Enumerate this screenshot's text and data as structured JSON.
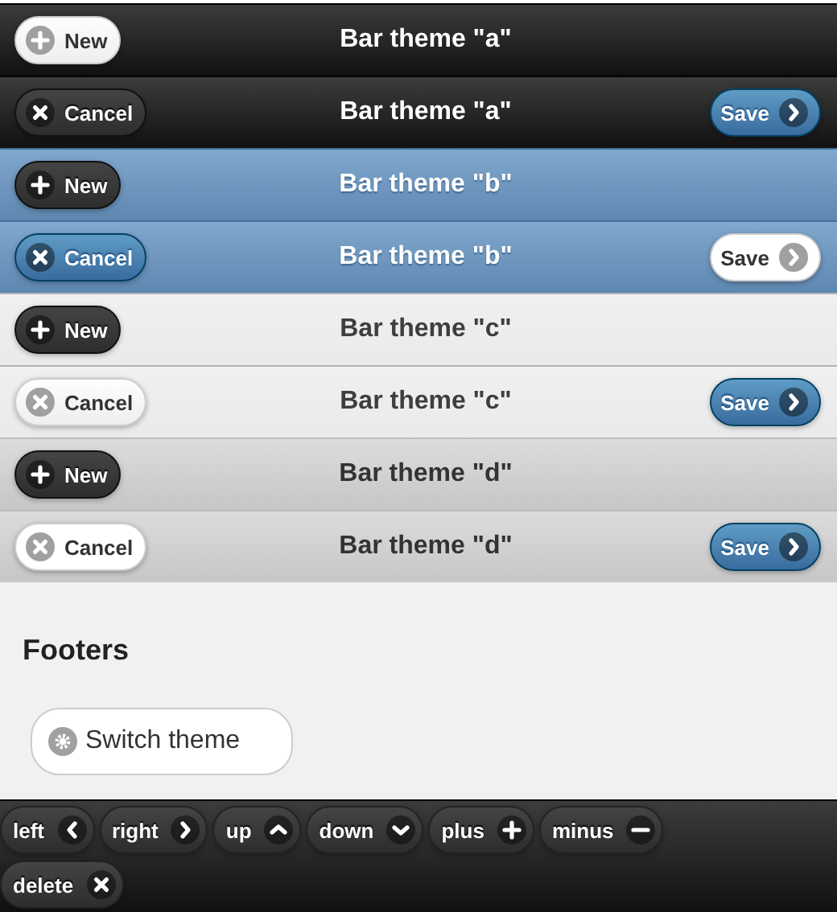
{
  "header_bars": [
    {
      "title": "Bar theme \"a\"",
      "left_button": {
        "label": "New",
        "kind": "add"
      }
    },
    {
      "title": "Bar theme \"a\"",
      "left_button": {
        "label": "Cancel",
        "kind": "cancel"
      },
      "right_button": {
        "label": "Save",
        "kind": "save"
      }
    },
    {
      "title": "Bar theme \"b\"",
      "left_button": {
        "label": "New",
        "kind": "add"
      }
    },
    {
      "title": "Bar theme \"b\"",
      "left_button": {
        "label": "Cancel",
        "kind": "cancel"
      },
      "right_button": {
        "label": "Save",
        "kind": "save"
      }
    },
    {
      "title": "Bar theme \"c\"",
      "left_button": {
        "label": "New",
        "kind": "add"
      }
    },
    {
      "title": "Bar theme \"c\"",
      "left_button": {
        "label": "Cancel",
        "kind": "cancel"
      },
      "right_button": {
        "label": "Save",
        "kind": "save"
      }
    },
    {
      "title": "Bar theme \"d\"",
      "left_button": {
        "label": "New",
        "kind": "add"
      }
    },
    {
      "title": "Bar theme \"d\"",
      "left_button": {
        "label": "Cancel",
        "kind": "cancel"
      },
      "right_button": {
        "label": "Save",
        "kind": "save"
      }
    }
  ],
  "content": {
    "heading": "Footers",
    "button": {
      "label": "Switch theme",
      "kind": "settings"
    }
  },
  "footer": {
    "buttons": [
      {
        "label": "left",
        "kind": "left"
      },
      {
        "label": "right",
        "kind": "right"
      },
      {
        "label": "up",
        "kind": "up"
      },
      {
        "label": "down",
        "kind": "down"
      },
      {
        "label": "plus",
        "kind": "add"
      },
      {
        "label": "minus",
        "kind": "remove"
      },
      {
        "label": "delete",
        "kind": "cancel"
      }
    ]
  }
}
